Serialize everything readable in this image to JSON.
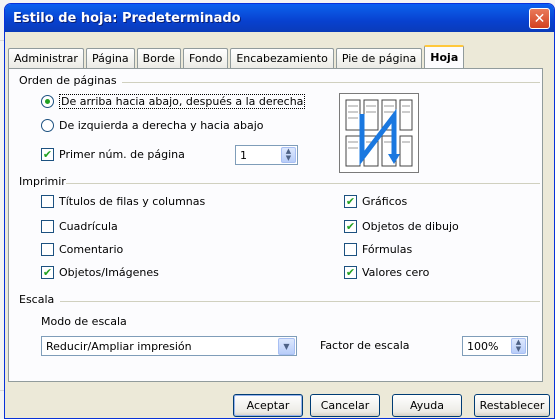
{
  "window": {
    "title": "Estilo de hoja: Predeterminado",
    "close_glyph": "✕"
  },
  "tabs": [
    {
      "label": "Administrar"
    },
    {
      "label": "Página"
    },
    {
      "label": "Borde"
    },
    {
      "label": "Fondo"
    },
    {
      "label": "Encabezamiento"
    },
    {
      "label": "Pie de página"
    },
    {
      "label": "Hoja",
      "active": true
    }
  ],
  "page_order": {
    "title": "Orden de páginas",
    "options": [
      {
        "label": "De arriba hacia abajo, después a la derecha",
        "selected": true
      },
      {
        "label": "De izquierda a derecha y hacia abajo",
        "selected": false
      }
    ],
    "first_page": {
      "label": "Primer núm. de página",
      "checked": true,
      "value": "1"
    },
    "preview_icon": "page-order-preview-icon"
  },
  "print": {
    "title": "Imprimir",
    "left": [
      {
        "label": "Títulos de filas y columnas",
        "checked": false
      },
      {
        "label": "Cuadrícula",
        "checked": false
      },
      {
        "label": "Comentario",
        "checked": false
      },
      {
        "label": "Objetos/Imágenes",
        "checked": true
      }
    ],
    "right": [
      {
        "label": "Gráficos",
        "checked": true
      },
      {
        "label": "Objetos de dibujo",
        "checked": true
      },
      {
        "label": "Fórmulas",
        "checked": false
      },
      {
        "label": "Valores cero",
        "checked": true
      }
    ]
  },
  "scale": {
    "title": "Escala",
    "mode_label": "Modo de escala",
    "mode_value": "Reducir/Ampliar impresión",
    "factor_label": "Factor de escala",
    "factor_value": "100%"
  },
  "footer": {
    "ok": "Aceptar",
    "cancel": "Cancelar",
    "help": "Ayuda",
    "reset": "Restablecer"
  },
  "colors": {
    "title_bar": "#0841d0",
    "check_mark": "#21a121",
    "preview_arrow": "#1a78e0"
  }
}
